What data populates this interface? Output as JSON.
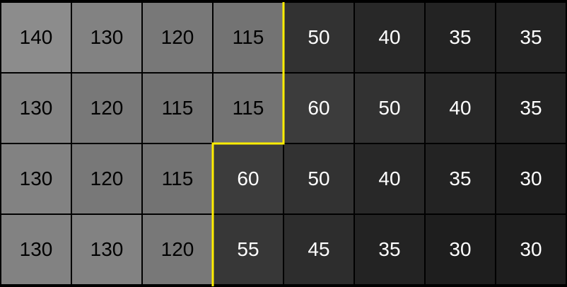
{
  "grid": {
    "rows": [
      [
        "140",
        "130",
        "120",
        "115",
        "50",
        "40",
        "35",
        "35"
      ],
      [
        "130",
        "120",
        "115",
        "115",
        "60",
        "50",
        "40",
        "35"
      ],
      [
        "130",
        "120",
        "115",
        "60",
        "50",
        "40",
        "35",
        "30"
      ],
      [
        "130",
        "130",
        "120",
        "55",
        "45",
        "35",
        "30",
        "30"
      ]
    ]
  },
  "colors": {
    "boundary": "#ffee00",
    "dark_text": "#ffffff",
    "light_text": "#000000",
    "grid_lines": "#000000"
  }
}
